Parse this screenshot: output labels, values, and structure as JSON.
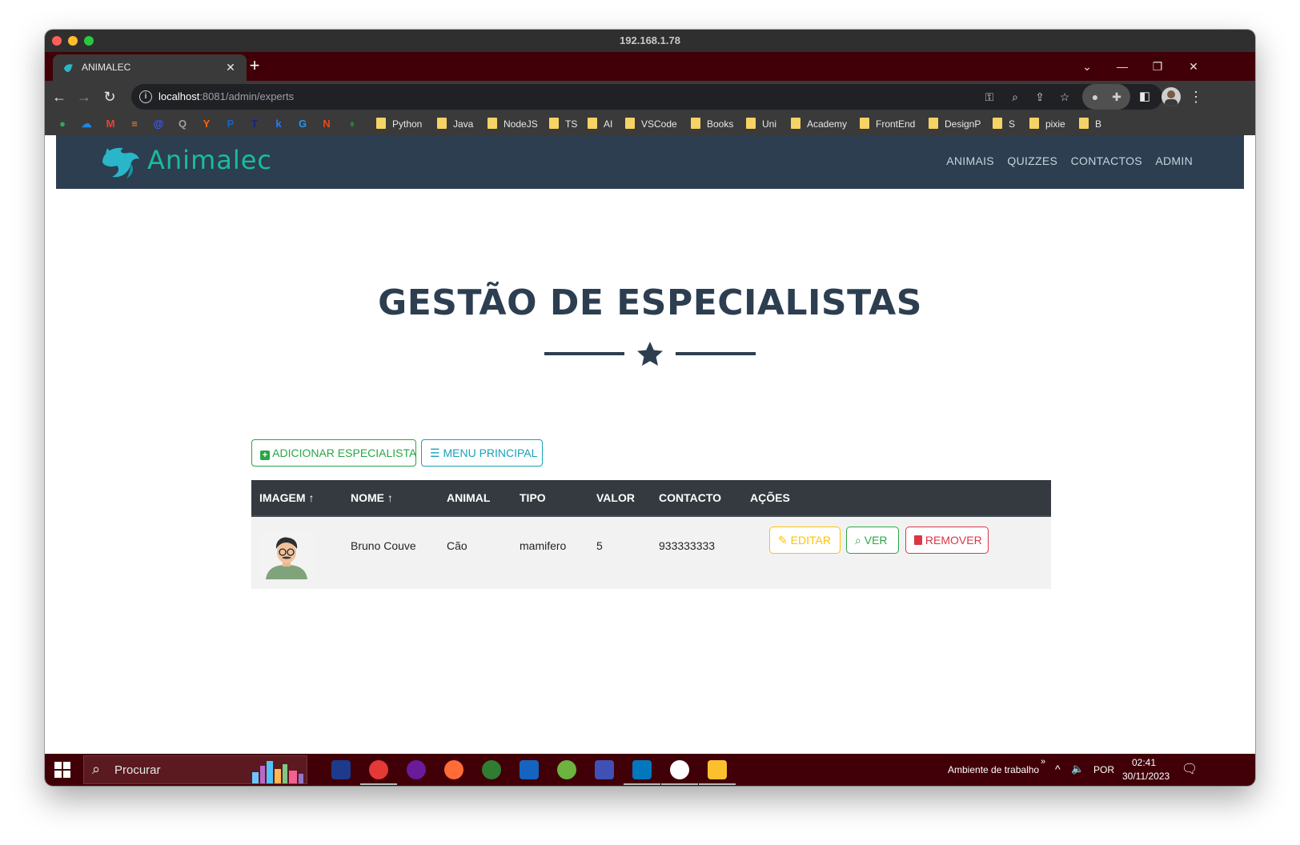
{
  "os": {
    "host_title": "192.168.1.78"
  },
  "browser": {
    "tab_title": "ANIMALEC",
    "url_host": "localhost",
    "url_rest": ":8081/admin/experts",
    "bookmarks": [
      "Python",
      "Java",
      "NodeJS",
      "TS",
      "AI",
      "VSCode",
      "Books",
      "Uni",
      "Academy",
      "FrontEnd",
      "DesignP",
      "S",
      "pixie",
      "B"
    ],
    "bookmark_favicons": [
      {
        "name": "green-icon",
        "color": "#34a853",
        "glyph": "●"
      },
      {
        "name": "cloud-icon",
        "color": "#1e88e5",
        "glyph": "☁"
      },
      {
        "name": "gmail-icon",
        "color": "#ea4335",
        "glyph": "M"
      },
      {
        "name": "stack-icon",
        "color": "#f48024",
        "glyph": "≡"
      },
      {
        "name": "at-icon",
        "color": "#3d5afe",
        "glyph": "@"
      },
      {
        "name": "search-bm-icon",
        "color": "#9e9e9e",
        "glyph": "Q"
      },
      {
        "name": "ycombinator-icon",
        "color": "#ff6600",
        "glyph": "Y"
      },
      {
        "name": "paypal-icon",
        "color": "#1565c0",
        "glyph": "P"
      },
      {
        "name": "t-icon",
        "color": "#1a237e",
        "glyph": "T"
      },
      {
        "name": "k-icon",
        "color": "#2979ff",
        "glyph": "k"
      },
      {
        "name": "loop-icon",
        "color": "#2196f3",
        "glyph": "G"
      },
      {
        "name": "n-icon",
        "color": "#e64a19",
        "glyph": "N"
      },
      {
        "name": "leaf-icon",
        "color": "#2e7d32",
        "glyph": "♦"
      }
    ]
  },
  "site": {
    "brand": "Animalec",
    "nav": [
      "ANIMAIS",
      "QUIZZES",
      "CONTACTOS",
      "ADMIN"
    ],
    "page_title": "GESTÃO DE ESPECIALISTAS",
    "buttons": {
      "add": "ADICIONAR ESPECIALISTA",
      "menu": "MENU PRINCIPAL"
    },
    "table": {
      "headers": [
        "IMAGEM",
        "NOME",
        "ANIMAL",
        "TIPO",
        "VALOR",
        "CONTACTO",
        "AÇÕES"
      ],
      "rows": [
        {
          "nome": "Bruno Couve",
          "animal": "Cão",
          "tipo": "mamifero",
          "valor": "5",
          "contacto": "933333333"
        }
      ],
      "actions": {
        "edit": "EDITAR",
        "view": "VER",
        "remove": "REMOVER"
      }
    }
  },
  "taskbar": {
    "search_placeholder": "Procurar",
    "desktop_label": "Ambiente de trabalho",
    "language": "POR",
    "time": "02:41",
    "date": "30/11/2023"
  },
  "colors": {
    "navbar": "#2c3e50",
    "brand": "#1abc9c",
    "success": "#28a745",
    "info": "#17a2b8",
    "warning": "#ffc107",
    "danger": "#dc3545",
    "browser_frame": "#410008"
  }
}
